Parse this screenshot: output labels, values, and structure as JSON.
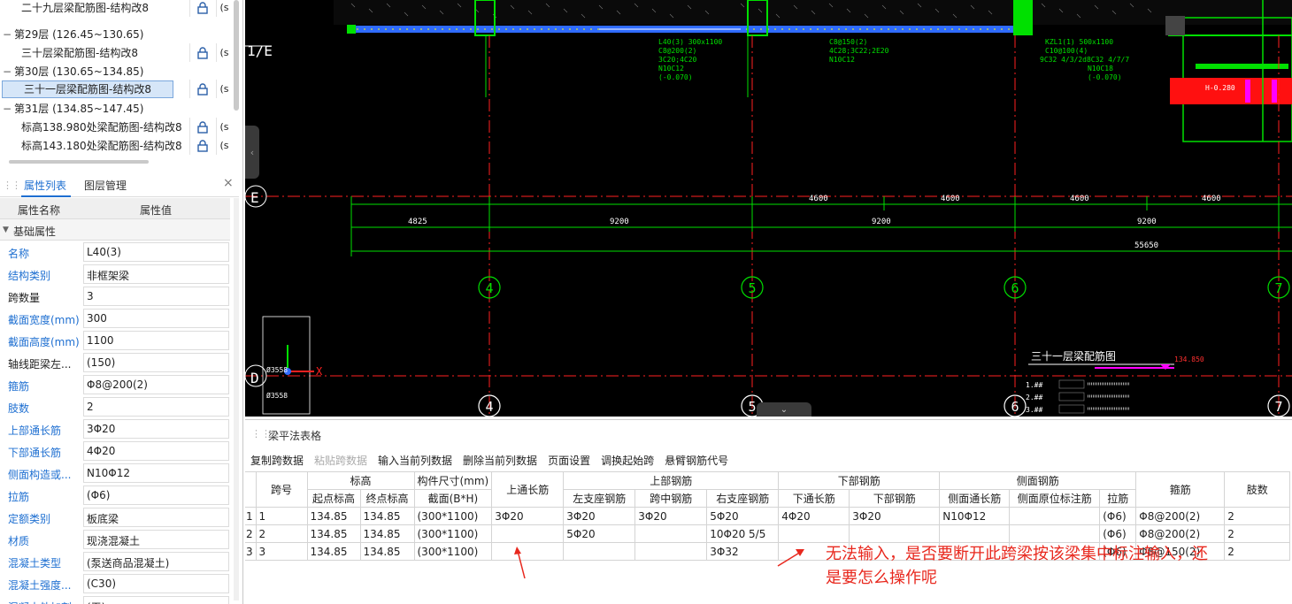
{
  "tree": {
    "rows": [
      {
        "type": "child",
        "label": "二十九层梁配筋图-结构改8",
        "lock": true
      },
      {
        "type": "floor",
        "label": "第29层 (126.45~130.65)"
      },
      {
        "type": "child",
        "label": "三十层梁配筋图-结构改8",
        "lock": true
      },
      {
        "type": "floor",
        "label": "第30层 (130.65~134.85)"
      },
      {
        "type": "selected",
        "label": "三十一层梁配筋图-结构改8",
        "lock": true
      },
      {
        "type": "floor",
        "label": "第31层 (134.85~147.45)"
      },
      {
        "type": "child",
        "label": "标高138.980处梁配筋图-结构改8",
        "lock": true
      },
      {
        "type": "child",
        "label": "标高143.180处梁配筋图-结构改8",
        "lock": true
      }
    ],
    "eye_glyph": "(s"
  },
  "props_panel": {
    "tab_attr": "属性列表",
    "tab_layer": "图层管理",
    "col_name": "属性名称",
    "col_value": "属性值",
    "group": "基础属性",
    "rows": [
      {
        "name": "名称",
        "value": "L40(3)",
        "blue": true
      },
      {
        "name": "结构类别",
        "value": "非框架梁",
        "blue": true
      },
      {
        "name": "跨数量",
        "value": "3",
        "blue": false
      },
      {
        "name": "截面宽度(mm)",
        "value": "300",
        "blue": true
      },
      {
        "name": "截面高度(mm)",
        "value": "1100",
        "blue": true
      },
      {
        "name": "轴线距梁左...",
        "value": "(150)",
        "blue": false
      },
      {
        "name": "箍筋",
        "value": "Φ8@200(2)",
        "blue": true
      },
      {
        "name": "肢数",
        "value": "2",
        "blue": true
      },
      {
        "name": "上部通长筋",
        "value": "3Φ20",
        "blue": true
      },
      {
        "name": "下部通长筋",
        "value": "4Φ20",
        "blue": true
      },
      {
        "name": "侧面构造或...",
        "value": "N10Φ12",
        "blue": true
      },
      {
        "name": "拉筋",
        "value": "(Φ6)",
        "blue": true
      },
      {
        "name": "定额类别",
        "value": "板底梁",
        "blue": true
      },
      {
        "name": "材质",
        "value": "现浇混凝土",
        "blue": true
      },
      {
        "name": "混凝土类型",
        "value": "(泵送商品混凝土)",
        "blue": true
      },
      {
        "name": "混凝土强度...",
        "value": "(C30)",
        "blue": true
      },
      {
        "name": "混凝土外加剂",
        "value": "(无)",
        "blue": true
      }
    ]
  },
  "cad": {
    "axis_left_labels": {
      "top": "1/E",
      "mid": "E",
      "low": "D"
    },
    "dims_row1": [
      "4600",
      "4600",
      "4600",
      "4600"
    ],
    "dims_row2": [
      "4825",
      "9200",
      "9200",
      "9200"
    ],
    "dim_total": "55650",
    "grid_bubbles": [
      "4",
      "5",
      "6",
      "7"
    ],
    "beam_text_1": [
      "L40(3) 300x1100",
      "C8@200(2)",
      "3C20;4C20",
      "N10C12",
      "(-0.070)"
    ],
    "beam_text_2": [
      "C8@150(2)",
      "4C28;3C22;2E20",
      "N10C12"
    ],
    "beam_text_3": [
      "KZL1(1) 500x1100",
      "C10@100(4)",
      "9C32 4/3/2d8C32 4/7/7",
      "N10C18",
      "(-0.070)"
    ],
    "legend_title": "三十一层梁配筋图",
    "legend_elev": "134.850",
    "legend_items": [
      "1.## ",
      "2.## ",
      "3.## "
    ],
    "red_mark": "H-0.280",
    "coord_text": [
      "Ø3558",
      "Ø3558"
    ],
    "small_label": "X"
  },
  "bottom": {
    "title": "梁平法表格",
    "toolbar": [
      {
        "label": "复制跨数据",
        "enabled": true
      },
      {
        "label": "粘贴跨数据",
        "enabled": false
      },
      {
        "label": "输入当前列数据",
        "enabled": true
      },
      {
        "label": "删除当前列数据",
        "enabled": true
      },
      {
        "label": "页面设置",
        "enabled": true
      },
      {
        "label": "调换起始跨",
        "enabled": true
      },
      {
        "label": "悬臂钢筋代号",
        "enabled": true
      }
    ],
    "headers_top": {
      "span": "跨号",
      "elev": "标高",
      "size": "构件尺寸(mm)",
      "top_through": "上通长筋",
      "upper": "上部钢筋",
      "lower": "下部钢筋",
      "side": "侧面钢筋",
      "stirrup": "箍筋",
      "legs": "肢数"
    },
    "headers_sub": {
      "start": "起点标高",
      "end": "终点标高",
      "section": "截面(B*H)",
      "left_support": "左支座钢筋",
      "mid": "跨中钢筋",
      "right_support": "右支座钢筋",
      "low_through": "下通长筋",
      "low_bar": "下部钢筋",
      "side_through": "侧面通长筋",
      "side_orig": "侧面原位标注筋",
      "tie": "拉筋"
    },
    "rows": [
      {
        "rn": "1",
        "span": "1",
        "start": "134.85",
        "end": "134.85",
        "section": "(300*1100)",
        "top": "3Φ20",
        "left": "3Φ20",
        "mid": "3Φ20",
        "right": "5Φ20",
        "low_through": "4Φ20",
        "low": "3Φ20",
        "side": "N10Φ12",
        "side_orig": "",
        "tie": "(Φ6)",
        "stirrup": "Φ8@200(2)",
        "legs": "2"
      },
      {
        "rn": "2",
        "span": "2",
        "start": "134.85",
        "end": "134.85",
        "section": "(300*1100)",
        "top": "",
        "left": "5Φ20",
        "mid": "",
        "right": "10Φ20 5/5",
        "low_through": "",
        "low": "",
        "side": "",
        "side_orig": "",
        "tie": "(Φ6)",
        "stirrup": "Φ8@200(2)",
        "legs": "2"
      },
      {
        "rn": "3",
        "span": "3",
        "start": "134.85",
        "end": "134.85",
        "section": "(300*1100)",
        "top": "",
        "left": "",
        "mid": "",
        "right": "3Φ32",
        "low_through": "",
        "low": "",
        "side": "",
        "side_orig": "",
        "tie": "(Φ6)",
        "stirrup": "Φ8@150(2)",
        "legs": "2"
      }
    ],
    "annotation_line1": "无法输入，是否要断开此跨梁按该梁集中标注输入，还",
    "annotation_line2": "是要怎么操作呢"
  }
}
